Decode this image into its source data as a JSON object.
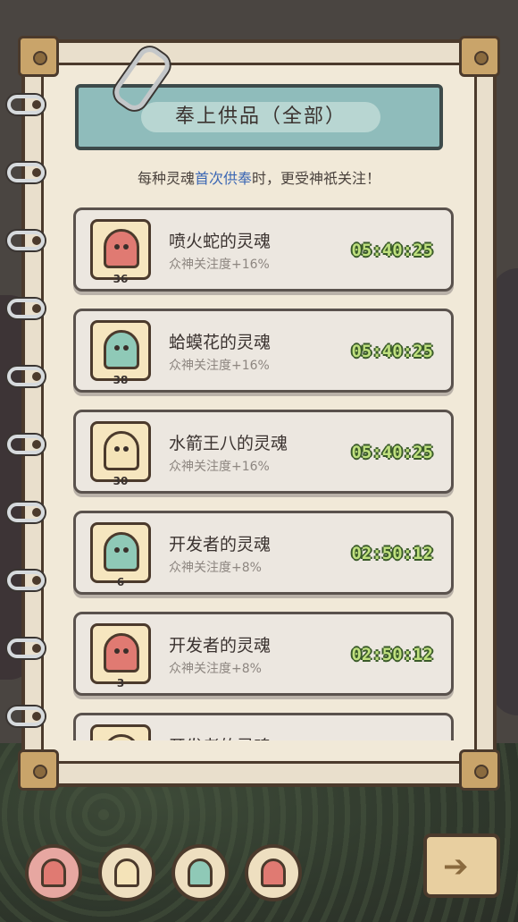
{
  "header": {
    "title": "奉上供品（全部）",
    "subtitle_pre": "每种灵魂",
    "subtitle_highlight": "首次供奉",
    "subtitle_post": "时，更受神祇关注！"
  },
  "colors": {
    "highlight": "#3b67b4",
    "timer": "#bfe07e",
    "red_ghost": "#e07a72",
    "teal_ghost": "#8fc9b7",
    "cream_ghost": "#f4e3b8"
  },
  "souls": [
    {
      "name": "喷火蛇的灵魂",
      "attention": "众神关注度+16%",
      "timer": "05:40:25",
      "level": "36",
      "ghost_color": "#e07a72",
      "icon": "red-ghost-icon"
    },
    {
      "name": "蛤蟆花的灵魂",
      "attention": "众神关注度+16%",
      "timer": "05:40:25",
      "level": "38",
      "ghost_color": "#8fc9b7",
      "icon": "teal-ghost-icon"
    },
    {
      "name": "水箭王八的灵魂",
      "attention": "众神关注度+16%",
      "timer": "05:40:25",
      "level": "30",
      "ghost_color": "#f4e3b8",
      "icon": "cream-ghost-icon"
    },
    {
      "name": "开发者的灵魂",
      "attention": "众神关注度+8%",
      "timer": "02:50:12",
      "level": "6",
      "ghost_color": "#8fc9b7",
      "icon": "teal-ghost-icon"
    },
    {
      "name": "开发者的灵魂",
      "attention": "众神关注度+8%",
      "timer": "02:50:12",
      "level": "3",
      "ghost_color": "#e07a72",
      "icon": "red-ghost-icon"
    },
    {
      "name": "开发者的灵魂",
      "attention": "",
      "timer": "",
      "level": "",
      "ghost_color": "#f4e3b8",
      "icon": "cream-ghost-icon"
    }
  ],
  "filters": [
    {
      "icon": "all-souls-icon",
      "color": "#e07a72",
      "active": true
    },
    {
      "icon": "cream-ghost-icon",
      "color": "#f4e3b8",
      "active": false
    },
    {
      "icon": "teal-ghost-icon",
      "color": "#8fc9b7",
      "active": false
    },
    {
      "icon": "red-ghost-icon",
      "color": "#e07a72",
      "active": false
    }
  ],
  "next_button": {
    "icon": "arrow-right-icon"
  }
}
